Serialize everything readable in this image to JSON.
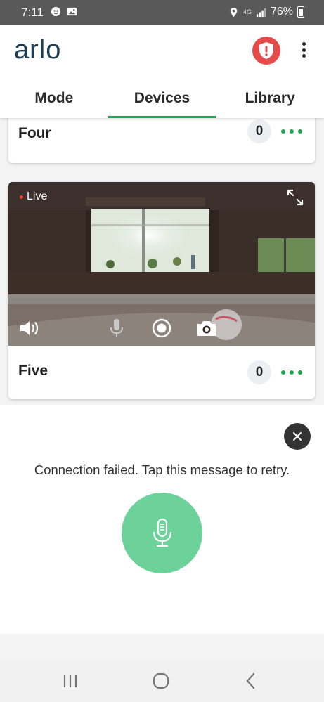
{
  "status_bar": {
    "time": "7:11",
    "network": "4G",
    "battery": "76%"
  },
  "header": {
    "logo": "arlo",
    "alert_icon": "shield-exclamation-icon",
    "menu_icon": "more-vertical-icon",
    "tabs": [
      {
        "label": "Mode",
        "active": false
      },
      {
        "label": "Devices",
        "active": true
      },
      {
        "label": "Library",
        "active": false
      }
    ]
  },
  "devices": [
    {
      "name": "Four",
      "count": "0"
    },
    {
      "name": "Five",
      "count": "0",
      "live_label": "Live"
    }
  ],
  "talk_sheet": {
    "message": "Connection failed. Tap this message to retry."
  },
  "colors": {
    "accent_green": "#1fa74f",
    "mic_green": "#6cd29a",
    "alert_red": "#e64b4b",
    "logo_navy": "#1c3f56"
  }
}
